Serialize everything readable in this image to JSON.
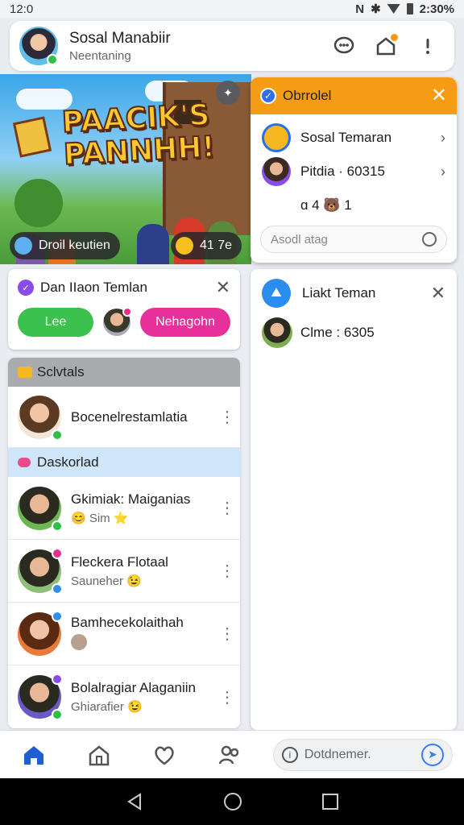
{
  "status_bar": {
    "time": "12:0",
    "clock_right": "2:30%",
    "icons": [
      "notification-n-icon",
      "bluetooth-icon",
      "wifi-icon",
      "battery-icon"
    ]
  },
  "header": {
    "title": "Sosal Manabiir",
    "subtitle": "Neentaning",
    "icons": [
      "chat-bubble-icon",
      "home-notification-icon",
      "more-icon"
    ]
  },
  "banner": {
    "title_line1": "PAACIK'S",
    "title_line2": "PANNHH!",
    "chip_left": "Droil keutien",
    "chip_right": "41 7e"
  },
  "popup": {
    "title": "Obrrolel",
    "rows": [
      {
        "label": "Sosal Temaran"
      },
      {
        "label": "Pitdia · 60315"
      },
      {
        "label": "ɑ 4 🐻 1"
      }
    ],
    "search_placeholder": "Asodl atag"
  },
  "request_card": {
    "title": "Dan IIaon Temlan",
    "accept_label": "Lee",
    "reject_label": "Nehagohn"
  },
  "list": {
    "header": "Sclvtals",
    "first_row": {
      "name": "Bocenelrestamlatia"
    },
    "section": "Daskorlad",
    "rows": [
      {
        "name": "Gkimiak: Maiganias",
        "sub": "😊 Sim ⭐"
      },
      {
        "name": "Fleckera Flotaal",
        "sub": "Sauneher 😉"
      },
      {
        "name": "Bamhecekolaithah",
        "sub": ""
      },
      {
        "name": "Bolalragiar Alaganiin",
        "sub": "Ghiarafier 😉"
      }
    ]
  },
  "chat_panel": {
    "title": "Liakt Teman",
    "row_label": "Clme : 6305"
  },
  "bottom_nav": {
    "search_placeholder": "Dotdnemer."
  },
  "colors": {
    "accent_orange": "#f59b14",
    "accept_green": "#3cc04e",
    "reject_pink": "#e8309a",
    "section_blue": "#cfe6fa",
    "active_nav": "#1f5fd6"
  }
}
